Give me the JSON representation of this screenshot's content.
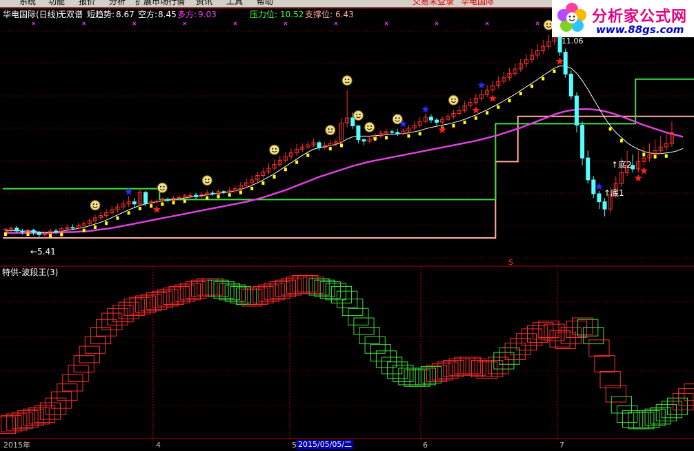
{
  "menubar": {
    "items": [
      "系统",
      "功能",
      "报价",
      "分析",
      "扩展市场行情",
      "资讯",
      "工具",
      "帮助"
    ],
    "status_left": "交易未登录",
    "status_right": "华电国际"
  },
  "logo": {
    "title": "分析家公式网",
    "url": "www.88gs.com"
  },
  "main_header": {
    "stock": "华电国际(日线)",
    "indicator": "无双谱",
    "short_label": "短趋势:",
    "short_value": "8.67",
    "bear_label": "空方:",
    "bear_value": "8.45",
    "bull_label": "多方:",
    "bull_value": "9.03",
    "resist_label": "压力位:",
    "resist_value": "10.52",
    "support_label": "支撑位:",
    "support_value": "6.43"
  },
  "annotations": {
    "low_mark": "←5.41",
    "high_mark": "11.06",
    "bottom1": "↑底1",
    "bottom2": "↑底2",
    "sell_mark": "S"
  },
  "sub_header": {
    "title": "特供-波段王(3)"
  },
  "time_axis": {
    "ticks": [
      "2015年",
      "4",
      "5",
      "6",
      "7"
    ],
    "cursor_date": "2015/05/05/二"
  },
  "colors": {
    "up_candle": "#ff3030",
    "down_candle": "#54ffff",
    "yellow_bar": "#ffff00",
    "ma_white": "#ffffff",
    "ma_magenta": "#e040e0",
    "resist_line": "#40e040",
    "support_line": "#ffb0a0",
    "grid": "#8b0000",
    "header_bull": "#ff40ff",
    "header_resist": "#40ff40"
  },
  "chart_data": {
    "type": "candlestick",
    "main_yrange": [
      4.9,
      11.4
    ],
    "candles": [
      [
        5.62,
        5.65,
        5.52,
        5.7
      ],
      [
        5.65,
        5.68,
        5.58,
        5.72
      ],
      [
        5.68,
        5.6,
        5.55,
        5.74
      ],
      [
        5.6,
        5.58,
        5.5,
        5.66
      ],
      [
        5.58,
        5.62,
        5.54,
        5.66
      ],
      [
        5.62,
        5.56,
        5.48,
        5.66
      ],
      [
        5.56,
        5.5,
        5.42,
        5.6
      ],
      [
        5.5,
        5.52,
        5.41,
        5.58
      ],
      [
        5.52,
        5.6,
        5.48,
        5.66
      ],
      [
        5.6,
        5.58,
        5.52,
        5.66
      ],
      [
        5.58,
        5.66,
        5.54,
        5.72
      ],
      [
        5.66,
        5.7,
        5.6,
        5.78
      ],
      [
        5.7,
        5.68,
        5.62,
        5.78
      ],
      [
        5.68,
        5.76,
        5.64,
        5.82
      ],
      [
        5.76,
        5.8,
        5.7,
        5.88
      ],
      [
        5.8,
        5.88,
        5.74,
        5.94
      ],
      [
        5.88,
        5.96,
        5.82,
        6.04
      ],
      [
        5.96,
        6.02,
        5.9,
        6.12
      ],
      [
        6.02,
        6.1,
        5.96,
        6.2
      ],
      [
        6.1,
        6.18,
        6.04,
        6.28
      ],
      [
        6.18,
        6.26,
        6.1,
        6.36
      ],
      [
        6.26,
        6.34,
        6.18,
        6.46
      ],
      [
        6.34,
        6.4,
        6.26,
        6.56
      ],
      [
        6.4,
        6.34,
        6.22,
        6.5
      ],
      [
        6.34,
        6.66,
        6.3,
        6.76
      ],
      [
        6.66,
        6.36,
        6.28,
        6.7
      ],
      [
        6.36,
        6.4,
        6.3,
        6.46
      ],
      [
        6.4,
        6.42,
        6.34,
        6.48
      ],
      [
        6.42,
        6.46,
        6.36,
        6.52
      ],
      [
        6.46,
        6.44,
        6.38,
        6.52
      ],
      [
        6.44,
        6.5,
        6.4,
        6.56
      ],
      [
        6.5,
        6.52,
        6.44,
        6.6
      ],
      [
        6.52,
        6.56,
        6.46,
        6.62
      ],
      [
        6.56,
        6.58,
        6.5,
        6.66
      ],
      [
        6.58,
        6.54,
        6.48,
        6.64
      ],
      [
        6.54,
        6.6,
        6.5,
        6.68
      ],
      [
        6.6,
        6.64,
        6.54,
        6.72
      ],
      [
        6.64,
        6.62,
        6.56,
        6.7
      ],
      [
        6.62,
        6.68,
        6.58,
        6.74
      ],
      [
        6.68,
        6.66,
        6.6,
        6.72
      ],
      [
        6.66,
        6.7,
        6.62,
        6.8
      ],
      [
        6.7,
        6.76,
        6.64,
        6.84
      ],
      [
        6.76,
        6.84,
        6.7,
        6.94
      ],
      [
        6.84,
        6.92,
        6.78,
        7.04
      ],
      [
        6.92,
        7.0,
        6.86,
        7.12
      ],
      [
        7.0,
        7.12,
        6.94,
        7.22
      ],
      [
        7.12,
        7.22,
        7.04,
        7.34
      ],
      [
        7.22,
        7.32,
        7.16,
        7.46
      ],
      [
        7.32,
        7.42,
        7.26,
        7.56
      ],
      [
        7.42,
        7.54,
        7.36,
        7.66
      ],
      [
        7.54,
        7.64,
        7.46,
        7.76
      ],
      [
        7.64,
        7.74,
        7.56,
        7.86
      ],
      [
        7.74,
        7.84,
        7.66,
        7.98
      ],
      [
        7.84,
        7.9,
        7.76,
        8.0
      ],
      [
        7.9,
        7.96,
        7.84,
        8.06
      ],
      [
        7.96,
        8.02,
        7.9,
        8.12
      ],
      [
        8.02,
        7.88,
        7.8,
        8.08
      ],
      [
        7.88,
        7.94,
        7.84,
        8.04
      ],
      [
        7.94,
        8.0,
        7.88,
        8.1
      ],
      [
        8.0,
        8.04,
        7.92,
        8.12
      ],
      [
        8.04,
        8.56,
        8.0,
        8.7
      ],
      [
        8.56,
        8.7,
        8.44,
        9.46
      ],
      [
        8.7,
        8.48,
        8.4,
        8.84
      ],
      [
        8.48,
        8.1,
        8.0,
        8.5
      ],
      [
        8.1,
        8.06,
        7.96,
        8.14
      ],
      [
        8.06,
        8.12,
        8.0,
        8.18
      ],
      [
        8.12,
        8.2,
        8.06,
        8.28
      ],
      [
        8.2,
        8.28,
        8.14,
        8.36
      ],
      [
        8.28,
        8.32,
        8.22,
        8.4
      ],
      [
        8.32,
        8.3,
        8.24,
        8.38
      ],
      [
        8.3,
        8.26,
        8.2,
        8.4
      ],
      [
        8.26,
        8.34,
        8.22,
        8.42
      ],
      [
        8.34,
        8.42,
        8.28,
        8.5
      ],
      [
        8.42,
        8.5,
        8.36,
        8.6
      ],
      [
        8.5,
        8.6,
        8.44,
        8.72
      ],
      [
        8.6,
        8.72,
        8.54,
        8.82
      ],
      [
        8.72,
        8.64,
        8.56,
        8.8
      ],
      [
        8.64,
        8.58,
        8.5,
        8.7
      ],
      [
        8.58,
        8.66,
        8.52,
        8.74
      ],
      [
        8.66,
        8.74,
        8.6,
        8.82
      ],
      [
        8.74,
        8.82,
        8.66,
        8.92
      ],
      [
        8.82,
        8.9,
        8.76,
        9.02
      ],
      [
        8.9,
        9.04,
        8.84,
        9.16
      ],
      [
        9.04,
        9.12,
        8.96,
        9.24
      ],
      [
        9.12,
        9.24,
        9.06,
        9.36
      ],
      [
        9.24,
        9.34,
        9.16,
        9.48
      ],
      [
        9.34,
        9.46,
        9.26,
        9.6
      ],
      [
        9.46,
        9.58,
        9.38,
        9.72
      ],
      [
        9.58,
        9.7,
        9.5,
        9.84
      ],
      [
        9.7,
        9.8,
        9.62,
        9.96
      ],
      [
        9.8,
        9.92,
        9.72,
        10.06
      ],
      [
        9.92,
        10.04,
        9.84,
        10.18
      ],
      [
        10.04,
        10.18,
        9.96,
        10.32
      ],
      [
        10.18,
        10.3,
        10.08,
        10.46
      ],
      [
        10.3,
        10.42,
        10.2,
        10.58
      ],
      [
        10.42,
        10.54,
        10.32,
        10.72
      ],
      [
        10.54,
        10.66,
        10.44,
        10.84
      ],
      [
        10.66,
        10.8,
        10.56,
        10.98
      ],
      [
        10.8,
        10.92,
        10.7,
        11.06
      ],
      [
        10.92,
        10.5,
        10.4,
        11.0
      ],
      [
        10.5,
        9.9,
        9.8,
        10.6
      ],
      [
        9.9,
        9.3,
        9.2,
        10.0
      ],
      [
        9.3,
        8.5,
        8.3,
        9.4
      ],
      [
        8.5,
        7.6,
        7.4,
        8.6
      ],
      [
        7.6,
        7.0,
        6.9,
        7.8
      ],
      [
        7.0,
        6.62,
        6.5,
        7.1
      ],
      [
        6.62,
        6.4,
        6.2,
        6.7
      ],
      [
        6.4,
        6.2,
        6.0,
        6.5
      ],
      [
        6.2,
        6.6,
        6.1,
        6.8
      ],
      [
        6.6,
        6.9,
        6.5,
        7.1
      ],
      [
        6.9,
        7.2,
        6.8,
        7.6
      ],
      [
        7.2,
        7.4,
        7.1,
        7.8
      ],
      [
        7.4,
        7.3,
        7.2,
        7.7
      ],
      [
        7.3,
        7.5,
        7.2,
        7.8
      ],
      [
        7.5,
        7.6,
        7.4,
        7.9
      ],
      [
        7.6,
        7.7,
        7.5,
        8.0
      ],
      [
        7.7,
        7.8,
        7.6,
        8.1
      ],
      [
        7.8,
        7.9,
        7.7,
        8.2
      ],
      [
        7.9,
        8.0,
        7.8,
        8.3
      ],
      [
        8.0,
        8.3,
        7.9,
        8.6
      ]
    ],
    "ma_short": [
      5.6,
      5.61,
      5.61,
      5.6,
      5.6,
      5.59,
      5.57,
      5.56,
      5.56,
      5.57,
      5.59,
      5.62,
      5.64,
      5.67,
      5.7,
      5.74,
      5.79,
      5.84,
      5.9,
      5.97,
      6.04,
      6.11,
      6.18,
      6.24,
      6.3,
      6.34,
      6.37,
      6.4,
      6.42,
      6.44,
      6.46,
      6.48,
      6.5,
      6.53,
      6.55,
      6.57,
      6.59,
      6.61,
      6.63,
      6.65,
      6.67,
      6.7,
      6.74,
      6.79,
      6.85,
      6.92,
      7.0,
      7.08,
      7.17,
      7.27,
      7.37,
      7.47,
      7.57,
      7.67,
      7.76,
      7.84,
      7.88,
      7.91,
      7.94,
      7.97,
      8.03,
      8.12,
      8.18,
      8.2,
      8.2,
      8.2,
      8.21,
      8.22,
      8.24,
      8.25,
      8.26,
      8.27,
      8.29,
      8.32,
      8.35,
      8.4,
      8.44,
      8.47,
      8.5,
      8.53,
      8.57,
      8.61,
      8.66,
      8.72,
      8.78,
      8.85,
      8.92,
      9.0,
      9.08,
      9.17,
      9.26,
      9.35,
      9.45,
      9.55,
      9.65,
      9.75,
      9.86,
      9.96,
      10.06,
      10.12,
      10.12,
      10.06,
      9.92,
      9.72,
      9.48,
      9.22,
      8.96,
      8.7,
      8.48,
      8.3,
      8.16,
      8.02,
      7.92,
      7.84,
      7.78,
      7.74,
      7.72,
      7.72,
      7.74,
      7.76,
      7.8,
      7.86
    ],
    "ma_long": [
      5.55,
      5.55,
      5.55,
      5.55,
      5.55,
      5.55,
      5.55,
      5.55,
      5.55,
      5.56,
      5.56,
      5.57,
      5.57,
      5.58,
      5.59,
      5.6,
      5.62,
      5.64,
      5.66,
      5.68,
      5.71,
      5.74,
      5.77,
      5.8,
      5.83,
      5.86,
      5.89,
      5.92,
      5.95,
      5.98,
      6.01,
      6.04,
      6.07,
      6.1,
      6.13,
      6.16,
      6.19,
      6.22,
      6.25,
      6.28,
      6.31,
      6.34,
      6.37,
      6.4,
      6.44,
      6.48,
      6.52,
      6.57,
      6.62,
      6.67,
      6.72,
      6.78,
      6.84,
      6.9,
      6.96,
      7.02,
      7.08,
      7.13,
      7.18,
      7.23,
      7.28,
      7.33,
      7.38,
      7.42,
      7.46,
      7.5,
      7.53,
      7.56,
      7.59,
      7.62,
      7.65,
      7.68,
      7.71,
      7.74,
      7.77,
      7.8,
      7.83,
      7.86,
      7.89,
      7.92,
      7.95,
      7.98,
      8.01,
      8.04,
      8.07,
      8.11,
      8.15,
      8.19,
      8.23,
      8.28,
      8.33,
      8.38,
      8.43,
      8.49,
      8.55,
      8.61,
      8.67,
      8.73,
      8.79,
      8.84,
      8.88,
      8.91,
      8.93,
      8.94,
      8.94,
      8.93,
      8.91,
      8.88,
      8.84,
      8.79,
      8.74,
      8.68,
      8.62,
      8.56,
      8.5,
      8.45,
      8.4,
      8.35,
      8.3,
      8.26,
      8.22,
      8.18
    ],
    "resist_line": [
      [
        0,
        6.76
      ],
      [
        28,
        6.76
      ],
      [
        28,
        6.46
      ],
      [
        88,
        6.46
      ],
      [
        88,
        8.54
      ],
      [
        113,
        8.54
      ],
      [
        113,
        9.76
      ],
      [
        148,
        9.76
      ],
      [
        148,
        10.52
      ],
      [
        156,
        10.52
      ]
    ],
    "support_line": [
      [
        0,
        5.41
      ],
      [
        88,
        5.41
      ],
      [
        88,
        7.5
      ],
      [
        92,
        7.5
      ],
      [
        92,
        8.74
      ],
      [
        135,
        8.74
      ],
      [
        135,
        6.2
      ],
      [
        156,
        6.2
      ]
    ],
    "osc": [
      0.05,
      0.06,
      0.07,
      0.08,
      0.09,
      0.1,
      0.11,
      0.12,
      0.14,
      0.17,
      0.21,
      0.26,
      0.32,
      0.38,
      0.44,
      0.5,
      0.56,
      0.62,
      0.67,
      0.71,
      0.74,
      0.76,
      0.78,
      0.8,
      0.81,
      0.82,
      0.83,
      0.84,
      0.85,
      0.86,
      0.87,
      0.88,
      0.89,
      0.9,
      0.91,
      0.92,
      0.93,
      0.93,
      0.92,
      0.91,
      0.9,
      0.89,
      0.88,
      0.87,
      0.86,
      0.87,
      0.88,
      0.89,
      0.9,
      0.91,
      0.92,
      0.93,
      0.94,
      0.95,
      0.95,
      0.94,
      0.93,
      0.92,
      0.91,
      0.9,
      0.88,
      0.85,
      0.8,
      0.74,
      0.68,
      0.62,
      0.56,
      0.51,
      0.47,
      0.43,
      0.4,
      0.38,
      0.36,
      0.35,
      0.35,
      0.36,
      0.37,
      0.38,
      0.39,
      0.4,
      0.41,
      0.42,
      0.43,
      0.43,
      0.42,
      0.41,
      0.4,
      0.41,
      0.43,
      0.46,
      0.49,
      0.52,
      0.55,
      0.58,
      0.61,
      0.63,
      0.65,
      0.66,
      0.64,
      0.6,
      0.59,
      0.62,
      0.66,
      0.68,
      0.67,
      0.62,
      0.54,
      0.44,
      0.34,
      0.25,
      0.18,
      0.12,
      0.09,
      0.08,
      0.08,
      0.09,
      0.1,
      0.11,
      0.13,
      0.15,
      0.17,
      0.2,
      0.23,
      0.26
    ],
    "osc_colors": "rrrrrrrrrrrrrrrrrrrrrrrrrrrrrrrrrrrrrrggggggrrrrrrrrrrrrgggggggggggggggggggggrrrrrrrrrrrrggrrrrrrrrrrrrrggrrrrgggggggggggrrrrrrrrrrrrr",
    "smileys_idx": [
      16,
      28,
      36,
      48,
      58,
      61,
      63,
      65,
      70,
      80,
      97
    ],
    "stars_blue_idx": [
      22,
      71,
      75,
      85,
      106
    ],
    "stars_red_idx": [
      27,
      78,
      84,
      87,
      99,
      113,
      114
    ]
  }
}
